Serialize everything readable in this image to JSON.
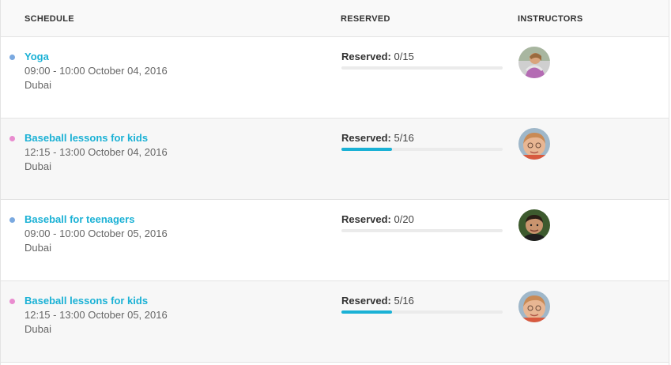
{
  "header": {
    "schedule": "SCHEDULE",
    "reserved": "RESERVED",
    "instructors": "INSTRUCTORS"
  },
  "reserved_label": "Reserved:",
  "rows": [
    {
      "title": "Yoga",
      "time": "09:00 - 10:00 October 04, 2016",
      "location": "Dubai",
      "reserved": "0/15",
      "fill_fraction": 0,
      "dot_color": "#7aa9e0",
      "avatar": "instructor-avatar-yoga"
    },
    {
      "title": "Baseball lessons for kids",
      "time": "12:15 - 13:00 October 04, 2016",
      "location": "Dubai",
      "reserved": "5/16",
      "fill_fraction": 0.3125,
      "dot_color": "#e98ccf",
      "avatar": "instructor-avatar-kids"
    },
    {
      "title": "Baseball for teenagers",
      "time": "09:00 - 10:00 October 05, 2016",
      "location": "Dubai",
      "reserved": "0/20",
      "fill_fraction": 0,
      "dot_color": "#7aa9e0",
      "avatar": "instructor-avatar-teen"
    },
    {
      "title": "Baseball lessons for kids",
      "time": "12:15 - 13:00 October 05, 2016",
      "location": "Dubai",
      "reserved": "5/16",
      "fill_fraction": 0.3125,
      "dot_color": "#e98ccf",
      "avatar": "instructor-avatar-kids"
    }
  ],
  "colors": {
    "accent": "#1ab1d5",
    "header_bg": "#f9f9f9",
    "row_alt_bg": "#f7f7f7"
  }
}
